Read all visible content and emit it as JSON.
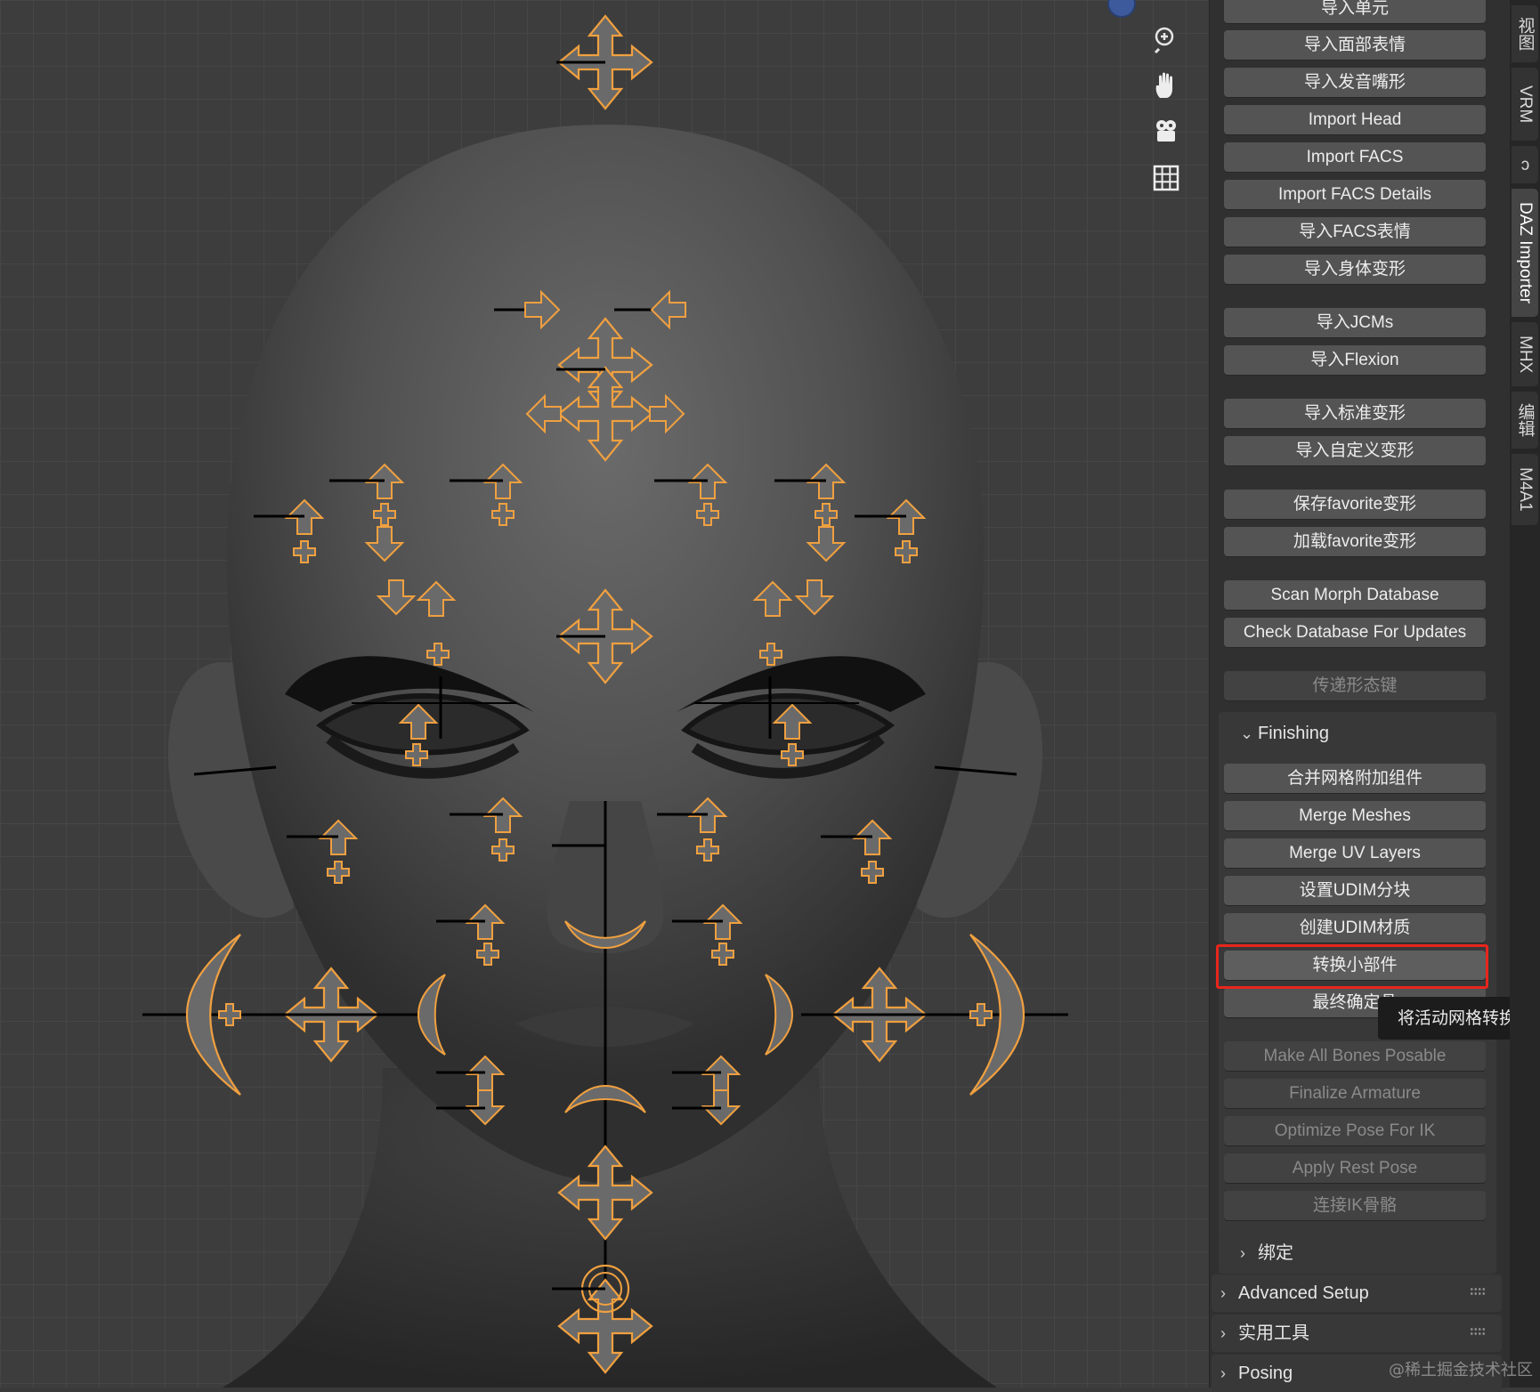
{
  "panel": {
    "buttons_top": [
      {
        "label": "导入单元",
        "enabled": true
      },
      {
        "label": "导入面部表情",
        "enabled": true
      },
      {
        "label": "导入发音嘴形",
        "enabled": true
      },
      {
        "label": "Import Head",
        "enabled": true
      },
      {
        "label": "Import FACS",
        "enabled": true
      },
      {
        "label": "Import FACS Details",
        "enabled": true
      },
      {
        "label": "导入FACS表情",
        "enabled": true
      },
      {
        "label": "导入身体变形",
        "enabled": true
      },
      {
        "label": "导入JCMs",
        "enabled": true
      },
      {
        "label": "导入Flexion",
        "enabled": true
      },
      {
        "label": "导入标准变形",
        "enabled": true
      },
      {
        "label": "导入自定义变形",
        "enabled": true
      },
      {
        "label": "保存favorite变形",
        "enabled": true
      },
      {
        "label": "加载favorite变形",
        "enabled": true
      },
      {
        "label": "Scan Morph Database",
        "enabled": true
      },
      {
        "label": "Check Database For Updates",
        "enabled": true
      },
      {
        "label": "传递形态键",
        "enabled": false
      }
    ],
    "finishing": {
      "title": "Finishing",
      "buttons": [
        {
          "label": "合并网格附加组件",
          "enabled": true
        },
        {
          "label": "Merge Meshes",
          "enabled": true
        },
        {
          "label": "Merge UV Layers",
          "enabled": true
        },
        {
          "label": "设置UDIM分块",
          "enabled": true
        },
        {
          "label": "创建UDIM材质",
          "enabled": true
        },
        {
          "label": "转换小部件",
          "enabled": true
        },
        {
          "label": "最终确定骨",
          "enabled": true
        },
        {
          "label": "Make All Bones Posable",
          "enabled": false
        },
        {
          "label": "Finalize Armature",
          "enabled": false
        },
        {
          "label": "Optimize Pose For IK",
          "enabled": false
        },
        {
          "label": "Apply Rest Pose",
          "enabled": false
        },
        {
          "label": "连接IK骨骼",
          "enabled": false
        }
      ]
    },
    "subsection_bind": "绑定",
    "sections": [
      "Advanced Setup",
      "实用工具",
      "Posing"
    ],
    "tooltip": "将活动网格转换为父",
    "highlight_color": "#e8261c"
  },
  "tabs": [
    "视图",
    "VRM",
    "ↄ",
    "DAZ Importer",
    "MHX",
    "编辑",
    "M4A1"
  ],
  "active_tab": "DAZ Importer",
  "watermark": "@稀土掘金技术社区",
  "viewport_tools": [
    "zoom-icon",
    "hand-pan-icon",
    "camera-icon",
    "grid-icon"
  ],
  "widget_color": "#f0a040"
}
